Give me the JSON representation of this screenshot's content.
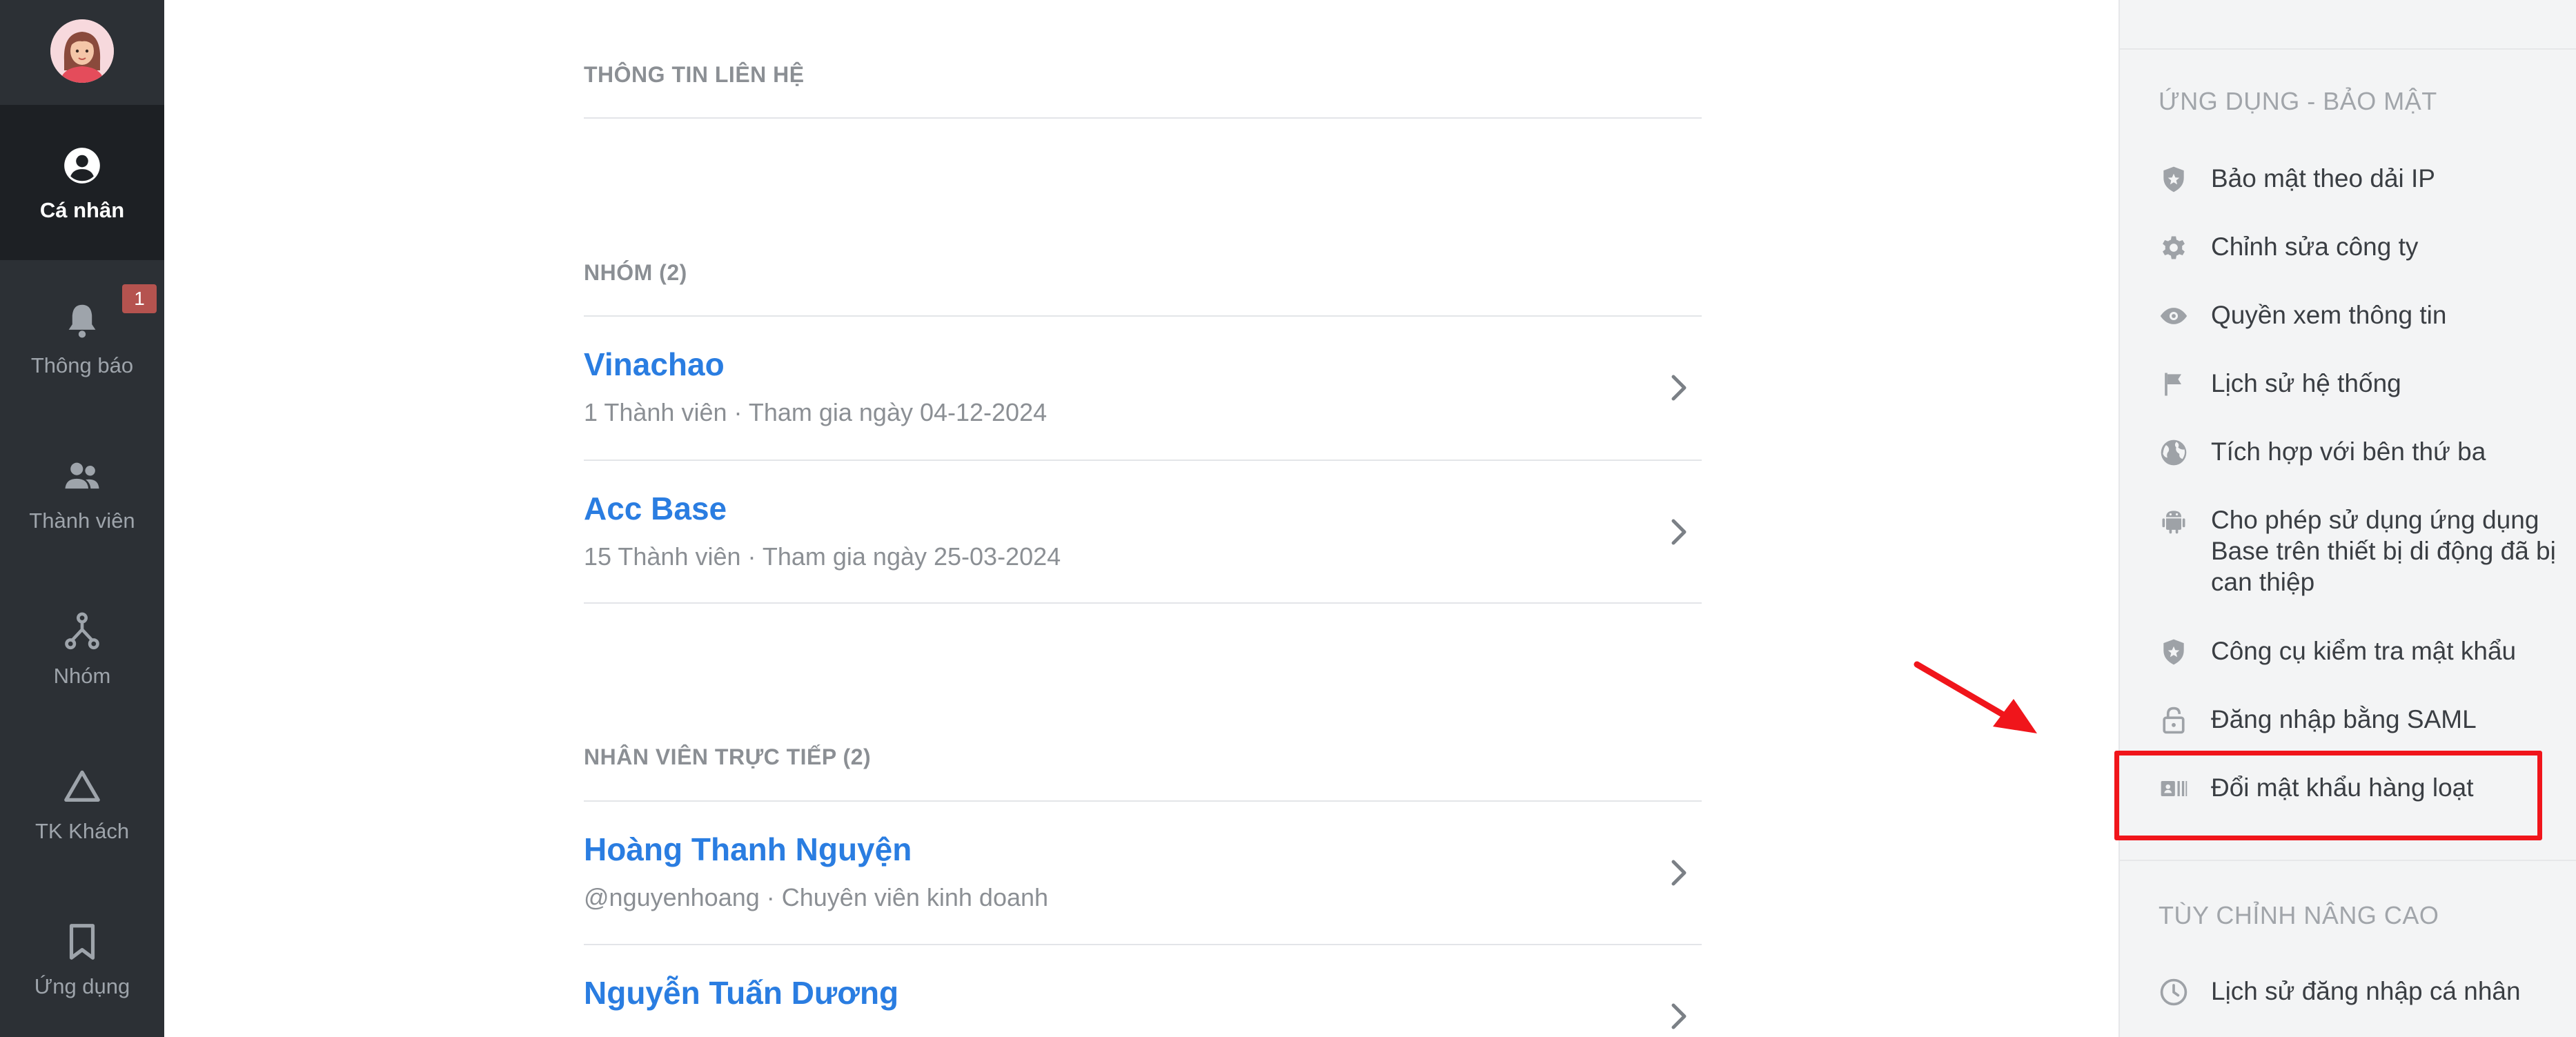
{
  "nav": {
    "items": [
      {
        "label": "Cá nhân",
        "icon": "user-circle-icon",
        "active": true
      },
      {
        "label": "Thông báo",
        "icon": "bell-icon",
        "badge": "1"
      },
      {
        "label": "Thành viên",
        "icon": "users-icon"
      },
      {
        "label": "Nhóm",
        "icon": "org-chart-icon"
      },
      {
        "label": "TK Khách",
        "icon": "triangle-icon"
      },
      {
        "label": "Ứng dụng",
        "icon": "bookmark-icon"
      }
    ]
  },
  "main": {
    "contact": {
      "title": "THÔNG TIN LIÊN HỆ"
    },
    "groups": {
      "title": "NHÓM (2)",
      "items": [
        {
          "name": "Vinachao",
          "meta": "1 Thành viên · Tham gia ngày 04-12-2024"
        },
        {
          "name": "Acc Base",
          "meta": "15 Thành viên · Tham gia ngày 25-03-2024"
        }
      ]
    },
    "direct": {
      "title": "NHÂN VIÊN TRỰC TIẾP (2)",
      "items": [
        {
          "name": "Hoàng Thanh Nguyện",
          "meta": "@nguyenhoang · Chuyên viên kinh doanh"
        },
        {
          "name": "Nguyễn Tuấn Dương",
          "meta": ""
        }
      ]
    }
  },
  "right": {
    "security": {
      "title": "ỨNG DỤNG - BẢO MẬT",
      "items": [
        {
          "label": "Bảo mật theo dải IP",
          "icon": "shield-star-icon"
        },
        {
          "label": "Chỉnh sửa công ty",
          "icon": "gear-icon"
        },
        {
          "label": "Quyền xem thông tin",
          "icon": "eye-icon"
        },
        {
          "label": "Lịch sử hệ thống",
          "icon": "flag-icon"
        },
        {
          "label": "Tích hợp với bên thứ ba",
          "icon": "globe-icon"
        },
        {
          "label": "Cho phép sử dụng ứng dụng Base trên thiết bị di động đã bị can thiệp",
          "icon": "android-icon"
        },
        {
          "label": "Công cụ kiểm tra mật khẩu",
          "icon": "shield-star-icon"
        },
        {
          "label": "Đăng nhập bằng SAML",
          "icon": "lock-open-icon"
        },
        {
          "label": "Đổi mật khẩu hàng loạt",
          "icon": "id-card-icon"
        }
      ]
    },
    "advanced": {
      "title": "TÙY CHỈNH NÂNG CAO",
      "items": [
        {
          "label": "Lịch sử đăng nhập cá nhân",
          "icon": "clock-icon"
        }
      ]
    }
  },
  "colors": {
    "nav_bg": "#2c3035",
    "nav_active_bg": "#1d2024",
    "link_blue": "#2a7de1",
    "badge_red": "#b5534f",
    "annotation_red": "#f0151b",
    "panel_bg": "#f3f4f5"
  }
}
